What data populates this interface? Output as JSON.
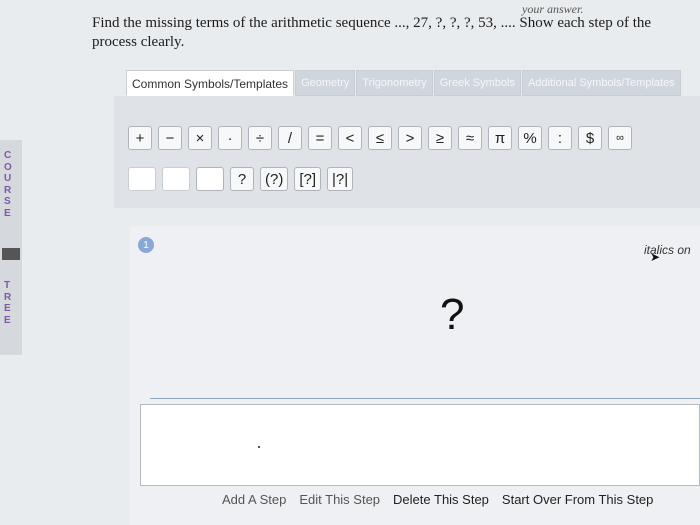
{
  "question": {
    "header_fragment": "your answer.",
    "text": "Find the missing terms of the arithmetic sequence ..., 27, ?, ?, ?, 53, .... Show each step of the process clearly."
  },
  "course_tree": {
    "word1": [
      "C",
      "O",
      "U",
      "R",
      "S",
      "E"
    ],
    "word2": [
      "T",
      "R",
      "E",
      "E"
    ]
  },
  "editor": {
    "tabs": [
      "Common Symbols/Templates",
      "Geometry",
      "Trigonometry",
      "Greek Symbols",
      "Additional Symbols/Templates"
    ],
    "row1": [
      "+",
      "−",
      "×",
      "·",
      "÷",
      "/",
      "=",
      "<",
      "≤",
      ">",
      "≥",
      "≈",
      "π",
      "%",
      ":",
      "$",
      "∞"
    ],
    "row2": [
      "?",
      "(?)",
      "[?]",
      "|?|"
    ]
  },
  "workspace": {
    "step_number": "1",
    "italics_label": "italics on",
    "placeholder": "?"
  },
  "actions": {
    "add_step": "Add A Step",
    "edit_step": "Edit This Step",
    "delete_step": "Delete This Step",
    "start_over": "Start Over From This Step"
  }
}
